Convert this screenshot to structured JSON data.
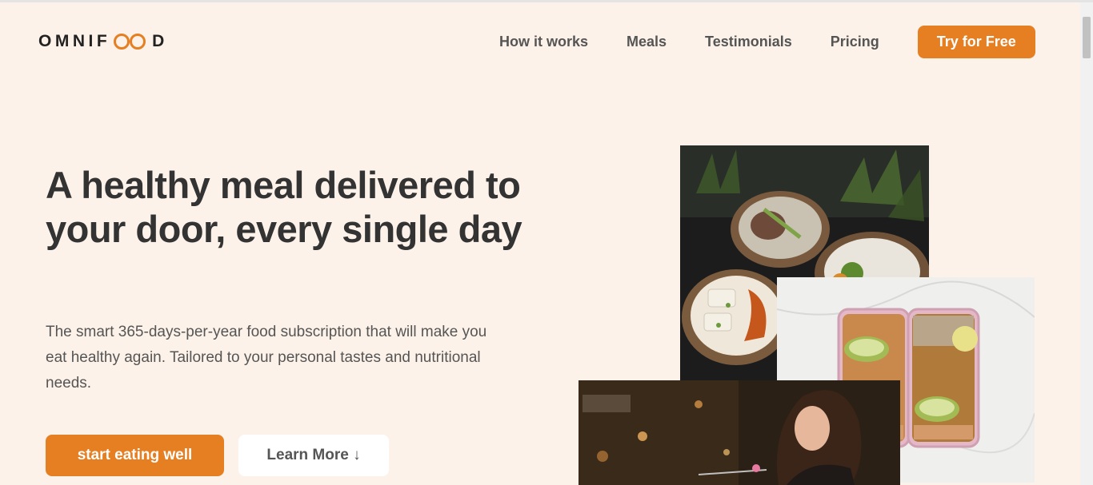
{
  "header": {
    "logo": {
      "text_before": "OMNIF",
      "text_after": "D",
      "mark": "infinity-loop-icon"
    },
    "nav": [
      {
        "label": "How it works"
      },
      {
        "label": "Meals"
      },
      {
        "label": "Testimonials"
      },
      {
        "label": "Pricing"
      }
    ],
    "cta_label": "Try for Free"
  },
  "hero": {
    "title": "A healthy meal delivered to your door, every single day",
    "description": "The smart 365-days-per-year food subscription that will make you eat healthy again. Tailored to your personal tastes and nutritional needs.",
    "primary_button": "start eating well",
    "secondary_button": "Learn More ↓"
  },
  "images": [
    {
      "name": "food-bowls-photo"
    },
    {
      "name": "meal-prep-boxes-photo"
    },
    {
      "name": "woman-eating-photo"
    }
  ],
  "colors": {
    "accent": "#e67e22",
    "background": "#fdf2e9",
    "text": "#333333"
  }
}
